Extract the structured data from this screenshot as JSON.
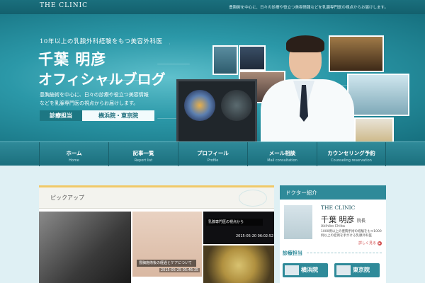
{
  "header": {
    "brand": "THE CLINIC",
    "tagline": "豊胸術を中心に、日々の診療や役立つ美容情報などを乳腺専門医の視点からお届けします。"
  },
  "hero": {
    "subtitle": "10年以上の乳腺外科経験をもつ美容外科医",
    "name": "千葉 明彦",
    "blog_title": "オフィシャルブログ",
    "desc_line1": "豊胸施術を中心に、日々の診療や役立つ美容情報",
    "desc_line2": "などを乳腺専門医の視点からお届けします。",
    "badge": "診療担当",
    "locations": "横浜院・東京院"
  },
  "nav": [
    {
      "jp": "ホーム",
      "en": "Home"
    },
    {
      "jp": "記事一覧",
      "en": "Report list"
    },
    {
      "jp": "プロフィール",
      "en": "Profile"
    },
    {
      "jp": "メール相談",
      "en": "Mail consultation"
    },
    {
      "jp": "カウンセリング予約",
      "en": "Counseling reservation"
    }
  ],
  "main": {
    "section_label": "ピックアップ",
    "posts": [
      {
        "caption": "豊胸施術後の経過とケアについて",
        "date": "2015-05-25 05:46:35"
      },
      {
        "caption": "乳腺専門医の視点から",
        "date": "2015-05-20 06:02:52"
      }
    ]
  },
  "sidebar": {
    "heading": "ドクター紹介",
    "clinic": "THE CLINIC",
    "doctor_name": "千葉 明彦",
    "doctor_title": "院長",
    "roman": "Akihiko Chiba",
    "bio": "1000例以上の豊胸手術の経験をもつ1000例以上の症例を手がける乳腺外科医",
    "more": "詳しく見る",
    "sub_heading": "診療担当",
    "loc1": "横浜院",
    "loc2": "東京院"
  },
  "colors": {
    "accent": "#2f8a99",
    "topbar": "#13606d",
    "highlight": "#f0c968",
    "link": "#d14b4b"
  }
}
